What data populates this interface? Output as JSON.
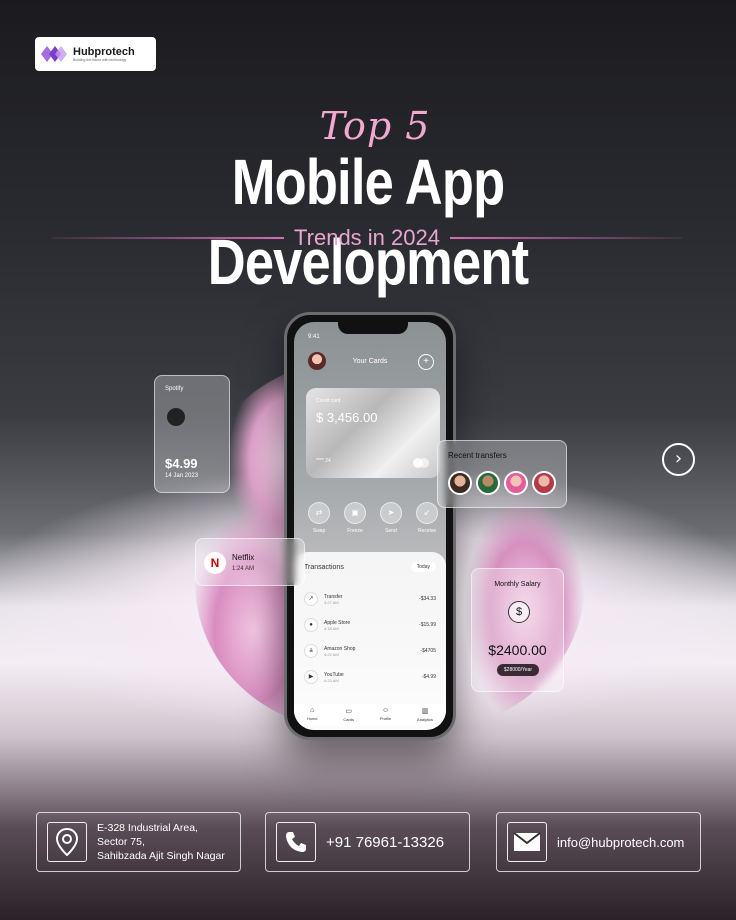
{
  "brand": {
    "name": "Hubprotech",
    "tagline": "Building the future with technology"
  },
  "hero": {
    "kicker": "Top 5",
    "title": "Mobile App Development",
    "subtitle": "Trends in 2024"
  },
  "phone": {
    "time": "9:41",
    "screen_title": "Your Cards",
    "card_label": "Credit card",
    "card_amount": "$ 3,456.00",
    "card_number": "**** 24",
    "actions": [
      "Swap",
      "Freeze",
      "Send",
      "Receive"
    ],
    "transactions_title": "Transactions",
    "filter": "Today",
    "transactions": [
      {
        "name": "Transfer",
        "time": "3:27 AM",
        "amount": "-$34.33"
      },
      {
        "name": "Apple Store",
        "time": "4:18 AM",
        "amount": "-$15.99"
      },
      {
        "name": "Amazon Shop",
        "time": "4:22 AM",
        "amount": "-$4705"
      },
      {
        "name": "YouTube",
        "time": "4:23 AM",
        "amount": "-$4.99"
      }
    ],
    "nav": [
      "Home",
      "Cards",
      "Profile",
      "Analytics"
    ]
  },
  "widgets": {
    "spotify": {
      "label": "Spotify",
      "amount": "$4.99",
      "date": "14 Jan 2023"
    },
    "transfers": {
      "label": "Recent transfers"
    },
    "netflix": {
      "label": "Netflix",
      "time": "1:24 AM"
    },
    "salary": {
      "label": "Monthly Salary",
      "amount": "$2400.00",
      "pill": "$28000/Year"
    }
  },
  "contact": {
    "address": [
      "E-328 Industrial Area,",
      "Sector 75,",
      "Sahibzada Ajit Singh Nagar"
    ],
    "phone": "+91 76961-13326",
    "email": "info@hubprotech.com"
  },
  "icons": {
    "logo": "hubprotech-logo-icon",
    "next": "chevron-right-icon",
    "location": "location-pin-icon",
    "phone": "phone-icon",
    "email": "envelope-icon"
  },
  "colors": {
    "accent_pink": "#e9a6cf",
    "brand_purple": "#7a3fc7"
  }
}
